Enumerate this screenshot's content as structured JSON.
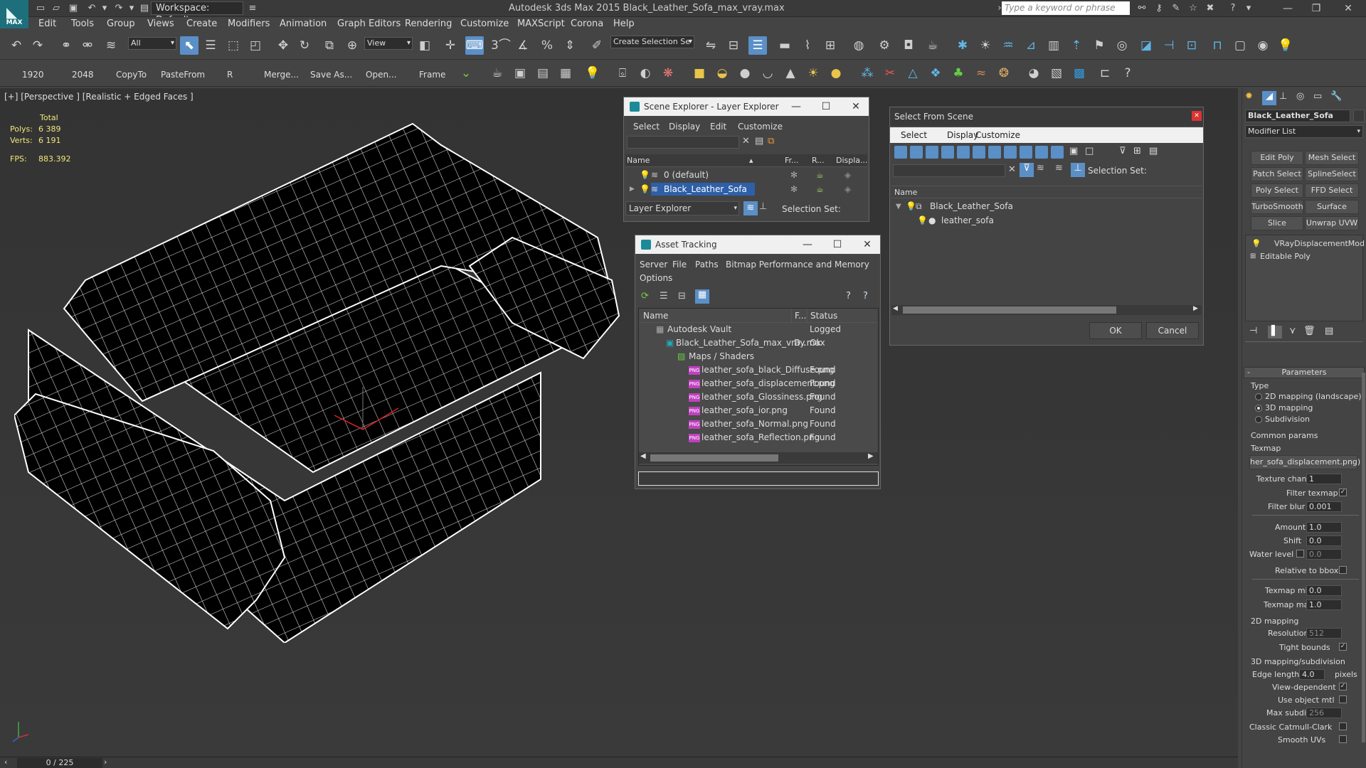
{
  "app": {
    "logo_text": "MAX",
    "workspace": "Workspace: Default",
    "window_title": "Autodesk 3ds Max  2015     Black_Leather_Sofa_max_vray.max",
    "search_placeholder": "Type a keyword or phrase"
  },
  "menu": [
    "Edit",
    "Tools",
    "Group",
    "Views",
    "Create",
    "Modifiers",
    "Animation",
    "Graph Editors",
    "Rendering",
    "Customize",
    "MAXScript",
    "Corona",
    "Help"
  ],
  "toolbar1": {
    "selection_filter": "All",
    "ref_coord": "View",
    "named_selection": "Create Selection Se",
    "snap_3": "3",
    "snap_percent": "%"
  },
  "toolbar2": {
    "buttons": [
      "1920",
      "2048",
      "CopyTo",
      "PasteFrom",
      "R",
      "Merge...",
      "Save As...",
      "Open...",
      "Frame"
    ]
  },
  "viewport": {
    "label": "[+] [Perspective ] [Realistic + Edged Faces ]",
    "total_label": "Total",
    "polys_label": "Polys:",
    "polys_value": "6 389",
    "verts_label": "Verts:",
    "verts_value": "6 191",
    "fps_label": "FPS:",
    "fps_value": "883.392"
  },
  "timeline": {
    "frames": "0 / 225"
  },
  "scene_explorer": {
    "title": "Scene Explorer - Layer Explorer",
    "menu": [
      "Select",
      "Display",
      "Edit",
      "Customize"
    ],
    "col_name": "Name",
    "col_fr": "Fr...",
    "col_r": "R...",
    "col_display": "Displa...",
    "rows": [
      "0 (default)",
      "Black_Leather_Sofa"
    ],
    "footer_dropdown": "Layer Explorer",
    "selection_set_label": "Selection Set:"
  },
  "asset_tracking": {
    "title": "Asset Tracking",
    "menu": [
      "Server",
      "File",
      "Paths",
      "Bitmap Performance and Memory",
      "Options"
    ],
    "col_name": "Name",
    "col_f": "F...",
    "col_status": "Status",
    "rows": [
      {
        "name": "Autodesk Vault",
        "f": "",
        "status": "Logged"
      },
      {
        "name": "Black_Leather_Sofa_max_vray.max",
        "f": "D..",
        "status": "Ok"
      },
      {
        "name": "Maps / Shaders",
        "f": "",
        "status": ""
      },
      {
        "name": "leather_sofa_black_Diffuse.png",
        "f": "",
        "status": "Found"
      },
      {
        "name": "leather_sofa_displacement.png",
        "f": "",
        "status": "Found"
      },
      {
        "name": "leather_sofa_Glossiness.png",
        "f": "",
        "status": "Found"
      },
      {
        "name": "leather_sofa_ior.png",
        "f": "",
        "status": "Found"
      },
      {
        "name": "leather_sofa_Normal.png",
        "f": "",
        "status": "Found"
      },
      {
        "name": "leather_sofa_Reflection.png",
        "f": "",
        "status": "Found"
      }
    ]
  },
  "select_from_scene": {
    "title": "Select From Scene",
    "menu": [
      "Select",
      "Display",
      "Customize"
    ],
    "selection_set_label": "Selection Set:",
    "col_name": "Name",
    "tree": [
      "Black_Leather_Sofa",
      "leather_sofa"
    ],
    "ok": "OK",
    "cancel": "Cancel"
  },
  "command_panel": {
    "object_name": "Black_Leather_Sofa",
    "modifier_list": "Modifier List",
    "buttons": [
      "Edit Poly",
      "Mesh Select",
      "Patch Select",
      "SplineSelect",
      "Poly Select",
      "FFD Select",
      "TurboSmooth",
      "Surface Select",
      "Slice",
      "Unwrap UVW"
    ],
    "stack": [
      "VRayDisplacementMod",
      "Editable Poly"
    ],
    "rollout_title": "Parameters",
    "type_label": "Type",
    "type_options": [
      "2D mapping (landscape)",
      "3D mapping",
      "Subdivision"
    ],
    "type_selected": 1,
    "common_params": "Common params",
    "texmap_label": "Texmap",
    "texmap_value": "her_sofa_displacement.png)",
    "texture_chan_label": "Texture chan",
    "texture_chan_value": "1",
    "filter_texmap_label": "Filter texmap",
    "filter_blur_label": "Filter blur",
    "filter_blur_value": "0.001",
    "amount_label": "Amount",
    "amount_value": "1.0",
    "shift_label": "Shift",
    "shift_value": "0.0",
    "water_level_label": "Water level",
    "water_level_value": "0.0",
    "relative_bbox_label": "Relative to bbox",
    "texmap_min_label": "Texmap min",
    "texmap_min_value": "0.0",
    "texmap_max_label": "Texmap max",
    "texmap_max_value": "1.0",
    "mapping2d_label": "2D mapping",
    "resolution_label": "Resolution",
    "resolution_value": "512",
    "tight_bounds_label": "Tight bounds",
    "mapping3d_label": "3D mapping/subdivision",
    "edge_length_label": "Edge length",
    "edge_length_value": "4.0",
    "pixels_label": "pixels",
    "view_dependent_label": "View-dependent",
    "use_object_mtl_label": "Use object mtl",
    "max_subdivs_label": "Max subdivs",
    "max_subdivs_value": "256",
    "classic_cc_label": "Classic Catmull-Clark",
    "smooth_uvs_label": "Smooth UVs"
  }
}
